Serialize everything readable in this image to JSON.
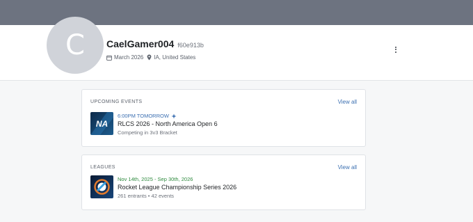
{
  "profile": {
    "avatar_letter": "C",
    "username": "CaelGamer004",
    "user_id": "f60e913b",
    "joined": "March 2026",
    "location": "IA, United States"
  },
  "upcoming": {
    "title": "UPCOMING EVENTS",
    "view_all": "View all",
    "event": {
      "time": "6:00PM TOMORROW",
      "name": "RLCS 2026 - North America Open 6",
      "status": "Competing in 3v3 Bracket",
      "thumb_text": "NA"
    }
  },
  "leagues": {
    "title": "LEAGUES",
    "view_all": "View all",
    "league": {
      "dates": "Nov 14th, 2025 - Sep 30th, 2026",
      "name": "Rocket League Championship Series 2026",
      "entrants": "261 entrants",
      "separator": "•",
      "events": "42 events"
    }
  },
  "colors": {
    "banner": "#6d7380",
    "accent_blue": "#3b6fb1",
    "accent_green": "#2e8a3e"
  }
}
